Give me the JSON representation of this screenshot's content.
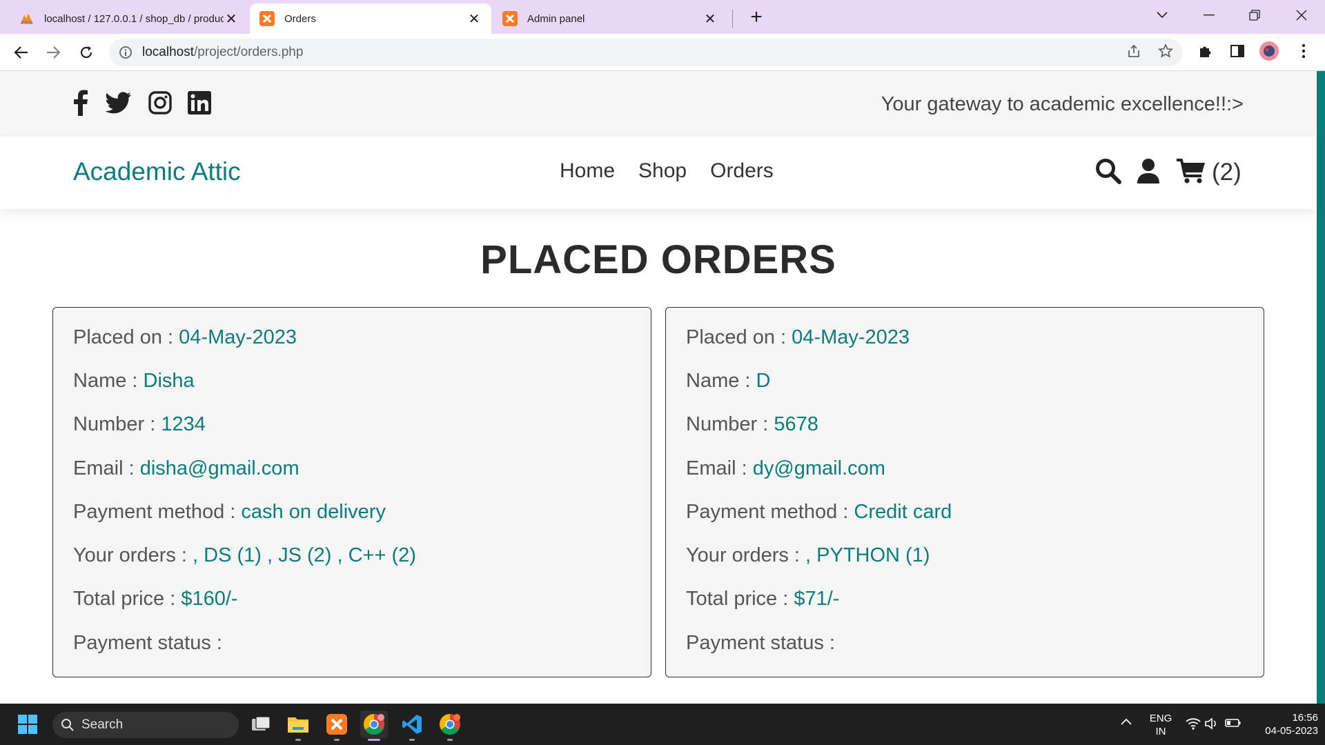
{
  "browser": {
    "tabs": [
      {
        "title": "localhost / 127.0.0.1 / shop_db / produc",
        "icon": "phpmyadmin-icon"
      },
      {
        "title": "Orders",
        "icon": "xampp-icon"
      },
      {
        "title": "Admin panel",
        "icon": "xampp-icon"
      }
    ],
    "url_host": "localhost",
    "url_path": "/project/orders.php"
  },
  "site": {
    "tagline": "Your gateway to academic excellence!!:>",
    "logo": "Academic Attic",
    "nav": [
      "Home",
      "Shop",
      "Orders"
    ],
    "cart_count": "(2)",
    "social_icons": [
      "facebook-icon",
      "twitter-icon",
      "instagram-icon",
      "linkedin-icon"
    ]
  },
  "page": {
    "heading": "PLACED ORDERS",
    "labels": {
      "placed_on": "Placed on : ",
      "name": "Name : ",
      "number": "Number : ",
      "email": "Email : ",
      "payment_method": "Payment method : ",
      "orders": "Your orders : ",
      "total": "Total price : ",
      "status": "Payment status : "
    },
    "orders": [
      {
        "placed_on": "04-May-2023",
        "name": "Disha",
        "number": "1234",
        "email": "disha@gmail.com",
        "payment_method": "cash on delivery",
        "products": ", DS (1) , JS (2) , C++ (2)",
        "total": "$160/-",
        "status": ""
      },
      {
        "placed_on": "04-May-2023",
        "name": "D",
        "number": "5678",
        "email": "dy@gmail.com",
        "payment_method": "Credit card",
        "products": ", PYTHON (1)",
        "total": "$71/-",
        "status": ""
      }
    ]
  },
  "taskbar": {
    "search_label": "Search",
    "lang_top": "ENG",
    "lang_bottom": "IN",
    "time": "16:56",
    "date": "04-05-2023"
  },
  "colors": {
    "accent": "#0d7c7d",
    "tabbar": "#e8d8f6",
    "taskbar": "#1f1f1f"
  }
}
